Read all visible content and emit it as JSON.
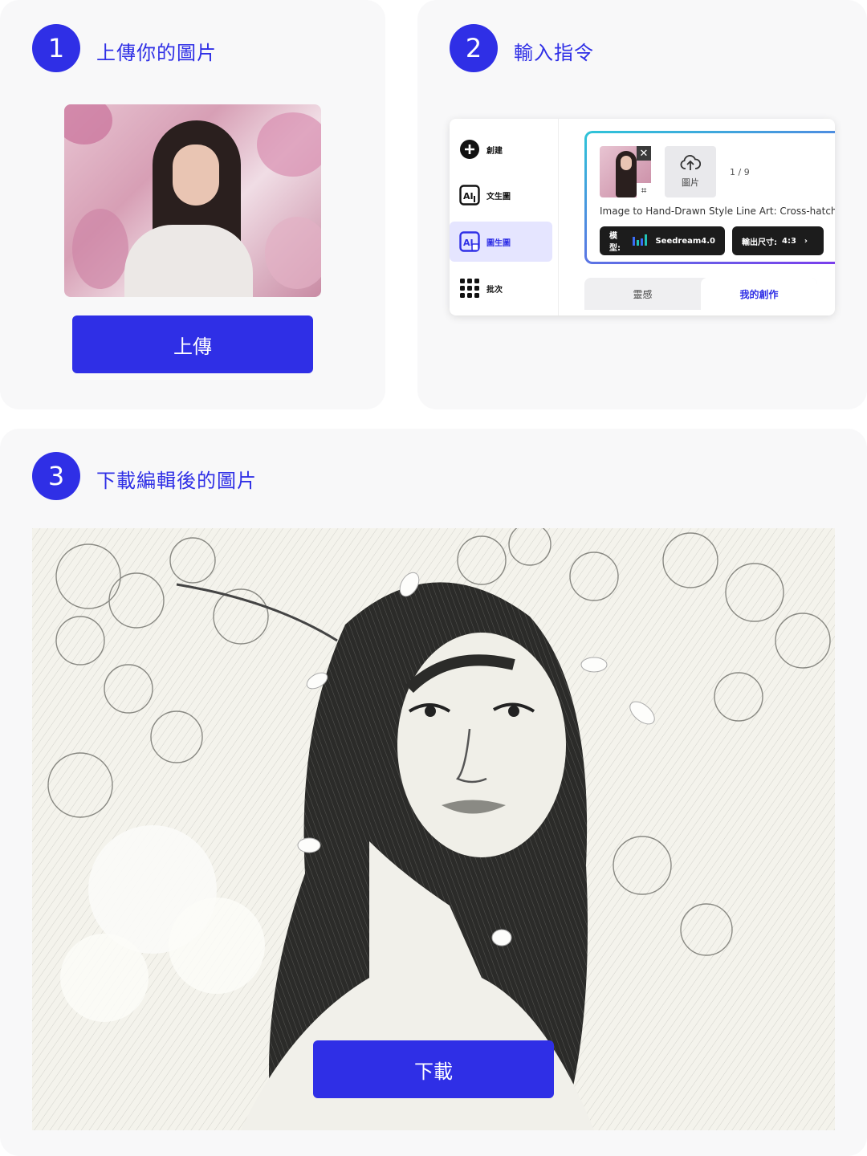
{
  "step1": {
    "number": "1",
    "title": "上傳你的圖片",
    "button_label": "上傳"
  },
  "step2": {
    "number": "2",
    "title": "輸入指令",
    "sidebar": {
      "items": [
        {
          "label": "創建",
          "icon": "plus-circle-icon"
        },
        {
          "label": "文生圖",
          "icon": "ai-text-image-icon"
        },
        {
          "label": "圖生圖",
          "icon": "ai-image-image-icon",
          "active": true
        },
        {
          "label": "批次",
          "icon": "grid-icon"
        }
      ]
    },
    "prompt_panel": {
      "upload_label": "圖片",
      "counter": "1 / 9",
      "prompt_text": "Image to Hand-Drawn Style Line Art: Cross-hatching",
      "model_label": "模型:",
      "model_value": "Seedream4.0",
      "size_label": "輸出尺寸:",
      "size_value": "4:3"
    },
    "tabs": {
      "inspire": "靈感",
      "mine": "我的創作"
    }
  },
  "step3": {
    "number": "3",
    "title": "下載編輯後的圖片",
    "button_label": "下載"
  },
  "colors": {
    "accent": "#2f2fe6",
    "card_bg": "#f8f8f9",
    "chip_bg": "#1c1c1c"
  }
}
